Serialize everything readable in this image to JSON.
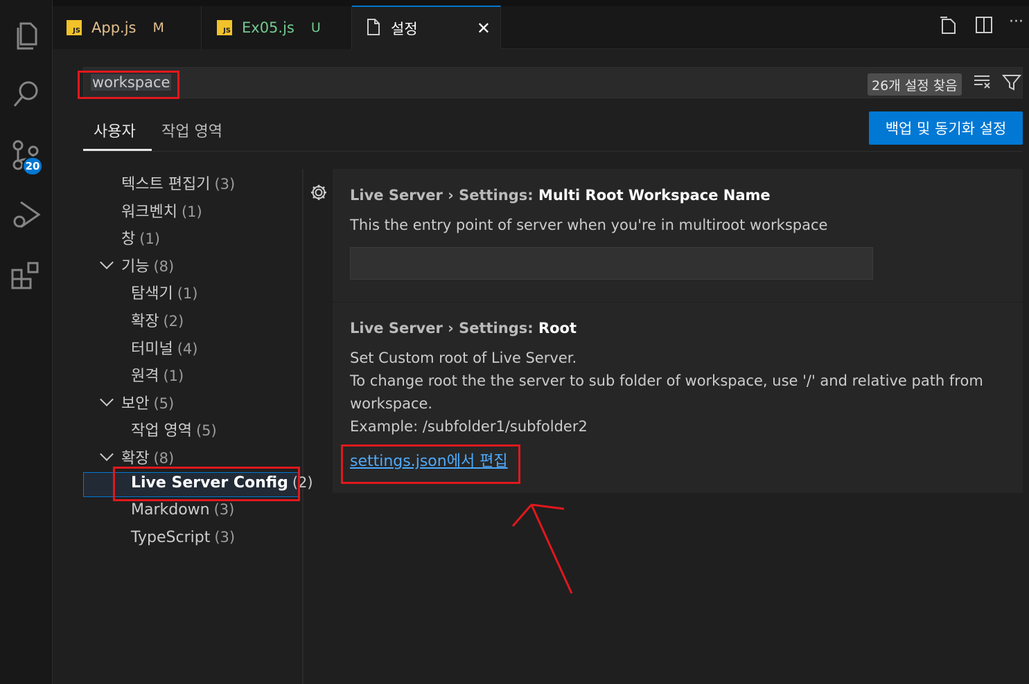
{
  "tabs": [
    {
      "label": "App.js",
      "status": "M",
      "icon": "js-icon",
      "color": "#e2c08d"
    },
    {
      "label": "Ex05.js",
      "status": "U",
      "icon": "js-icon",
      "color": "#73c991"
    },
    {
      "label": "설정",
      "icon": "file-icon",
      "close": "✕"
    }
  ],
  "activity": {
    "scm_badge": "20"
  },
  "search": {
    "value": "workspace",
    "found": "26개 설정 찾음"
  },
  "scope": {
    "user": "사용자",
    "workspace": "작업 영역",
    "sync_button": "백업 및 동기화 설정"
  },
  "toc": [
    {
      "label": "텍스트 편집기",
      "count": "(3)"
    },
    {
      "label": "워크벤치",
      "count": "(1)"
    },
    {
      "label": "창",
      "count": "(1)"
    },
    {
      "label": "기능",
      "count": "(8)"
    },
    {
      "label": "탐색기",
      "count": "(1)"
    },
    {
      "label": "확장",
      "count": "(2)"
    },
    {
      "label": "터미널",
      "count": "(4)"
    },
    {
      "label": "원격",
      "count": "(1)"
    },
    {
      "label": "보안",
      "count": "(5)"
    },
    {
      "label": "작업 영역",
      "count": "(5)"
    },
    {
      "label": "확장",
      "count": "(8)"
    },
    {
      "label": "Live Server Config",
      "count": "(2)"
    },
    {
      "label": "Markdown",
      "count": "(3)"
    },
    {
      "label": "TypeScript",
      "count": "(3)"
    }
  ],
  "settings": [
    {
      "category": "Live Server › Settings: ",
      "key": "Multi Root Workspace Name",
      "description": "This the entry point of server when you're in multiroot workspace",
      "value": ""
    },
    {
      "category": "Live Server › Settings: ",
      "key": "Root",
      "description_lines": [
        "Set Custom root of Live Server.",
        "To change root the the server to sub folder of workspace, use '/' and relative path from",
        "workspace.",
        "Example: /subfolder1/subfolder2"
      ],
      "link": "settings.json에서 편집"
    }
  ],
  "colors": {
    "accent": "#0078d4",
    "annotation": "#e0181d",
    "link": "#4daafc"
  }
}
